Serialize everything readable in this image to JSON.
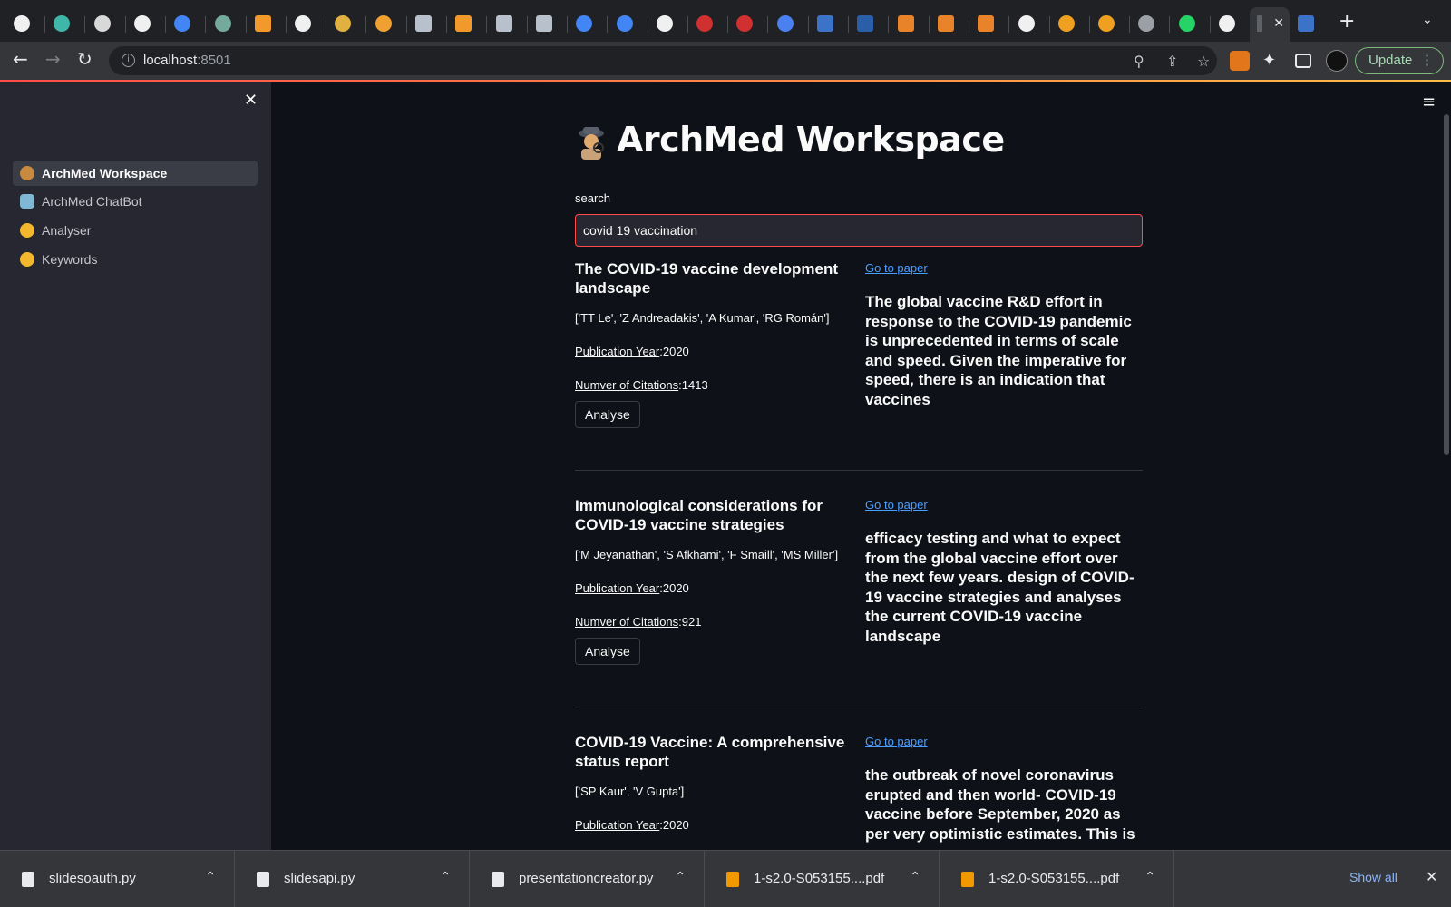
{
  "browser": {
    "tab_icons": [
      "github-icon",
      "share-icon",
      "diamond-icon",
      "github-icon",
      "google-icon",
      "chatgpt-icon",
      "api-icon",
      "github-icon",
      "chrome-icon",
      "rainbow-icon",
      "doc-icon",
      "api-icon",
      "doc-icon",
      "doc-icon",
      "google-icon",
      "google-icon",
      "github-icon",
      "crown-icon",
      "crown-icon",
      "scholar-icon",
      "arrow-icon",
      "ieee-icon",
      "e-icon",
      "e-icon",
      "e-icon",
      "github-icon",
      "infinity-icon",
      "infinity-icon",
      "globe-icon",
      "whatsapp-icon",
      "github-icon"
    ],
    "active_tab_close": "✕",
    "url_host": "localhost",
    "url_port": ":8501",
    "update_label": "Update"
  },
  "sidebar": {
    "items": [
      {
        "label": "ArchMed Workspace",
        "active": true,
        "icon": "detective-icon"
      },
      {
        "label": "ArchMed ChatBot",
        "active": false,
        "icon": "robot-icon"
      },
      {
        "label": "Analyser",
        "active": false,
        "icon": "thinking-face-icon"
      },
      {
        "label": "Keywords",
        "active": false,
        "icon": "thinking-face-icon"
      }
    ]
  },
  "main": {
    "title": "ArchMed Workspace",
    "search": {
      "label": "search",
      "value": "covid 19 vaccination"
    },
    "results": [
      {
        "title": "The COVID-19 vaccine development landscape",
        "authors": "['TT Le', 'Z Andreadakis', 'A Kumar', 'RG Román']",
        "year_label": "Publication Year",
        "year": ":2020",
        "citations_label": "Numver of Citations",
        "citations": ":1413",
        "button": "Analyse",
        "link": "Go to paper",
        "abstract": "The global vaccine R&D effort in response to the COVID-19 pandemic is unprecedented in terms of scale and speed. Given the imperative for speed, there is an indication that vaccines"
      },
      {
        "title": "Immunological considerations for COVID-19 vaccine strategies",
        "authors": "['M Jeyanathan', 'S Afkhami', 'F Smaill', 'MS Miller']",
        "year_label": "Publication Year",
        "year": ":2020",
        "citations_label": "Numver of Citations",
        "citations": ":921",
        "button": "Analyse",
        "link": "Go to paper",
        "abstract": "efficacy testing and what to expect from the global vaccine effort over the next few years. design of COVID-19 vaccine strategies and analyses the current COVID-19 vaccine landscape"
      },
      {
        "title": "COVID-19 Vaccine: A comprehensive status report",
        "authors": "['SP Kaur', 'V Gupta']",
        "year_label": "Publication Year",
        "year": ":2020",
        "link": "Go to paper",
        "abstract": "the outbreak of novel coronavirus erupted and then world- COVID-19 vaccine before September, 2020 as per very optimistic estimates. This is"
      }
    ]
  },
  "downloads": {
    "items": [
      {
        "name": "slidesoauth.py",
        "type": "py"
      },
      {
        "name": "slidesapi.py",
        "type": "py"
      },
      {
        "name": "presentationcreator.py",
        "type": "py"
      },
      {
        "name": "1-s2.0-S053155....pdf",
        "type": "pdf"
      },
      {
        "name": "1-s2.0-S053155....pdf",
        "type": "pdf"
      }
    ],
    "show_all": "Show all"
  },
  "colors": {
    "accent": "#ff4b4b",
    "link": "#4a9eff",
    "sidebar_bg": "#262730",
    "main_bg": "#0e1117"
  }
}
